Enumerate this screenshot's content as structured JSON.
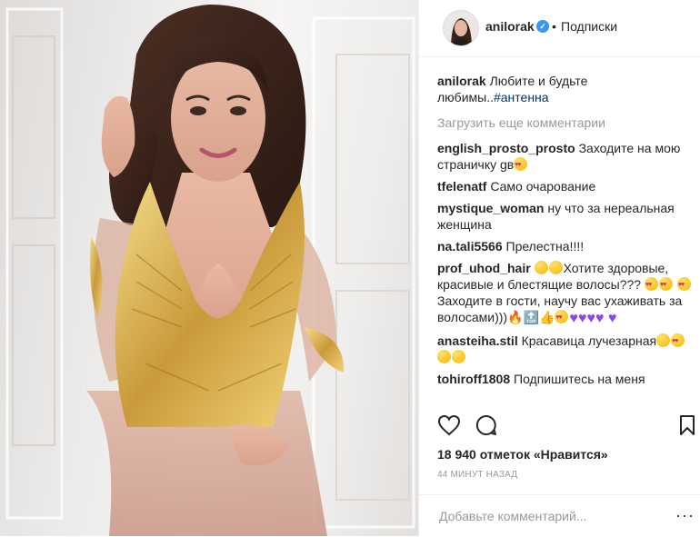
{
  "post": {
    "username": "anilorak",
    "follow_label": "Подписки",
    "dot": "•",
    "caption_text": "Любите и будьте любимы..",
    "caption_tag": "#антенна",
    "load_more": "Загрузить еще комментарии"
  },
  "comments": [
    {
      "user": "english_prosto_prosto",
      "text": "Заходите на мою страничку gв"
    },
    {
      "user": "tfelenatf",
      "text": "Само очарование"
    },
    {
      "user": "mystique_woman",
      "text": "ну что за нереальная женщина"
    },
    {
      "user": "na.tali5566",
      "text": "Прелестна!!!!"
    },
    {
      "user": "prof_uhod_hair",
      "text_a": "Хотите здоровые, красивые и блестящие волосы???",
      "text_b": "Заходите в гости, научу вас ухаживать за волосами)))"
    },
    {
      "user": "anasteiha.stil",
      "text": "Красавица лучезарная"
    },
    {
      "user": "tohiroff1808",
      "text": "Подпишитесь на меня"
    }
  ],
  "footer": {
    "likes": "18 940 отметок «Нравится»",
    "time": "44 МИНУТ НАЗАД",
    "comment_placeholder": "Добавьте комментарий...",
    "more": "···"
  },
  "icons": [
    "heart-icon",
    "comment-icon",
    "bookmark-icon",
    "verified-badge-icon",
    "more-options-icon"
  ],
  "colors": {
    "link": "#003569",
    "verified": "#3897f0",
    "muted": "#999999"
  }
}
